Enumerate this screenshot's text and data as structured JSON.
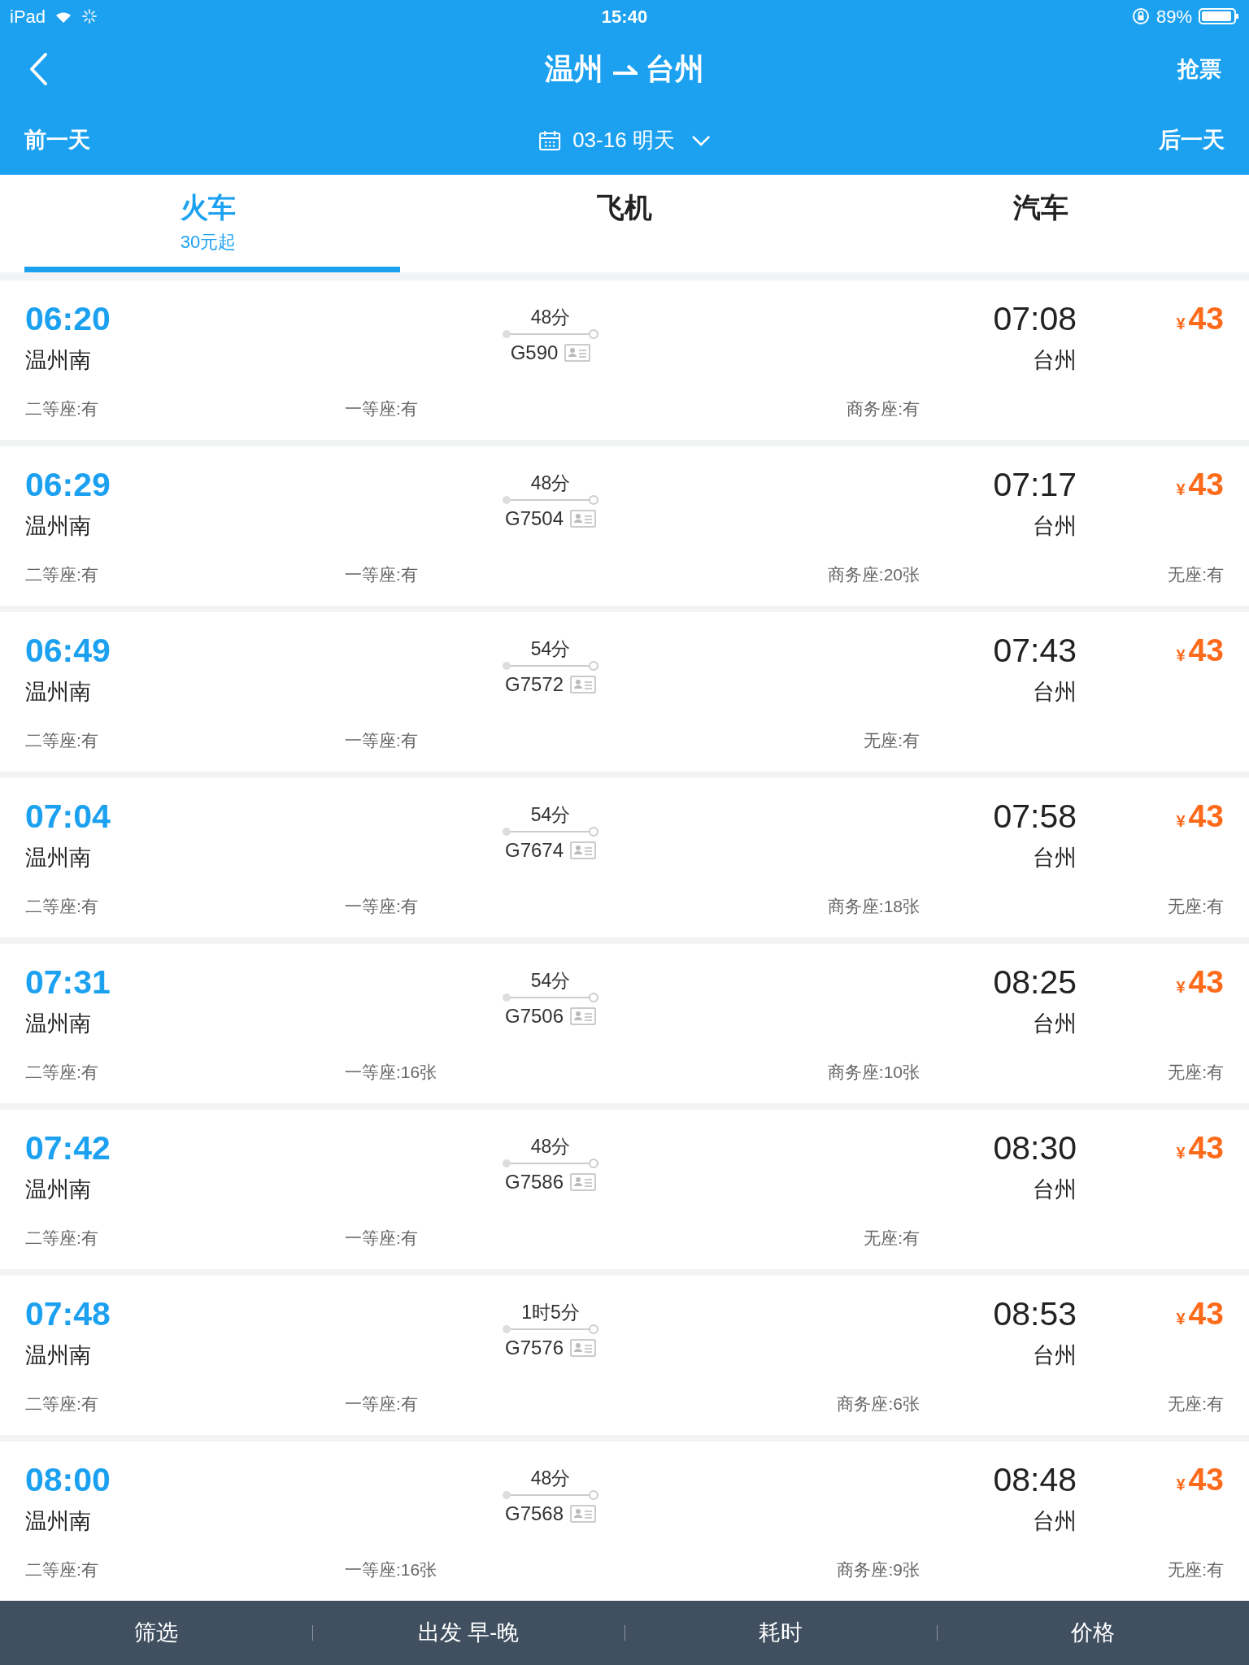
{
  "status_bar": {
    "device": "iPad",
    "time": "15:40",
    "battery": "89%"
  },
  "nav": {
    "title_from": "温州",
    "title_to": "台州",
    "action": "抢票"
  },
  "date_bar": {
    "prev": "前一天",
    "date": "03-16 明天",
    "next": "后一天"
  },
  "tabs": [
    {
      "label": "火车",
      "note": "30元起",
      "selected": true
    },
    {
      "label": "飞机",
      "selected": false
    },
    {
      "label": "汽车",
      "selected": false
    }
  ],
  "trains": [
    {
      "depart": "06:20",
      "from": "温州南",
      "duration": "48分",
      "number": "G590",
      "arrive": "07:08",
      "to": "台州",
      "currency": "¥",
      "price": "43",
      "seats": [
        "二等座:有",
        "一等座:有",
        "商务座:有"
      ]
    },
    {
      "depart": "06:29",
      "from": "温州南",
      "duration": "48分",
      "number": "G7504",
      "arrive": "07:17",
      "to": "台州",
      "currency": "¥",
      "price": "43",
      "seats": [
        "二等座:有",
        "一等座:有",
        "商务座:20张",
        "无座:有"
      ]
    },
    {
      "depart": "06:49",
      "from": "温州南",
      "duration": "54分",
      "number": "G7572",
      "arrive": "07:43",
      "to": "台州",
      "currency": "¥",
      "price": "43",
      "seats": [
        "二等座:有",
        "一等座:有",
        "无座:有"
      ]
    },
    {
      "depart": "07:04",
      "from": "温州南",
      "duration": "54分",
      "number": "G7674",
      "arrive": "07:58",
      "to": "台州",
      "currency": "¥",
      "price": "43",
      "seats": [
        "二等座:有",
        "一等座:有",
        "商务座:18张",
        "无座:有"
      ]
    },
    {
      "depart": "07:31",
      "from": "温州南",
      "duration": "54分",
      "number": "G7506",
      "arrive": "08:25",
      "to": "台州",
      "currency": "¥",
      "price": "43",
      "seats": [
        "二等座:有",
        "一等座:16张",
        "商务座:10张",
        "无座:有"
      ]
    },
    {
      "depart": "07:42",
      "from": "温州南",
      "duration": "48分",
      "number": "G7586",
      "arrive": "08:30",
      "to": "台州",
      "currency": "¥",
      "price": "43",
      "seats": [
        "二等座:有",
        "一等座:有",
        "无座:有"
      ]
    },
    {
      "depart": "07:48",
      "from": "温州南",
      "duration": "1时5分",
      "number": "G7576",
      "arrive": "08:53",
      "to": "台州",
      "currency": "¥",
      "price": "43",
      "seats": [
        "二等座:有",
        "一等座:有",
        "商务座:6张",
        "无座:有"
      ]
    },
    {
      "depart": "08:00",
      "from": "温州南",
      "duration": "48分",
      "number": "G7568",
      "arrive": "08:48",
      "to": "台州",
      "currency": "¥",
      "price": "43",
      "seats": [
        "二等座:有",
        "一等座:16张",
        "商务座:9张",
        "无座:有"
      ]
    }
  ],
  "bottom_bar": [
    "筛选",
    "出发 早-晚",
    "耗时",
    "价格"
  ]
}
